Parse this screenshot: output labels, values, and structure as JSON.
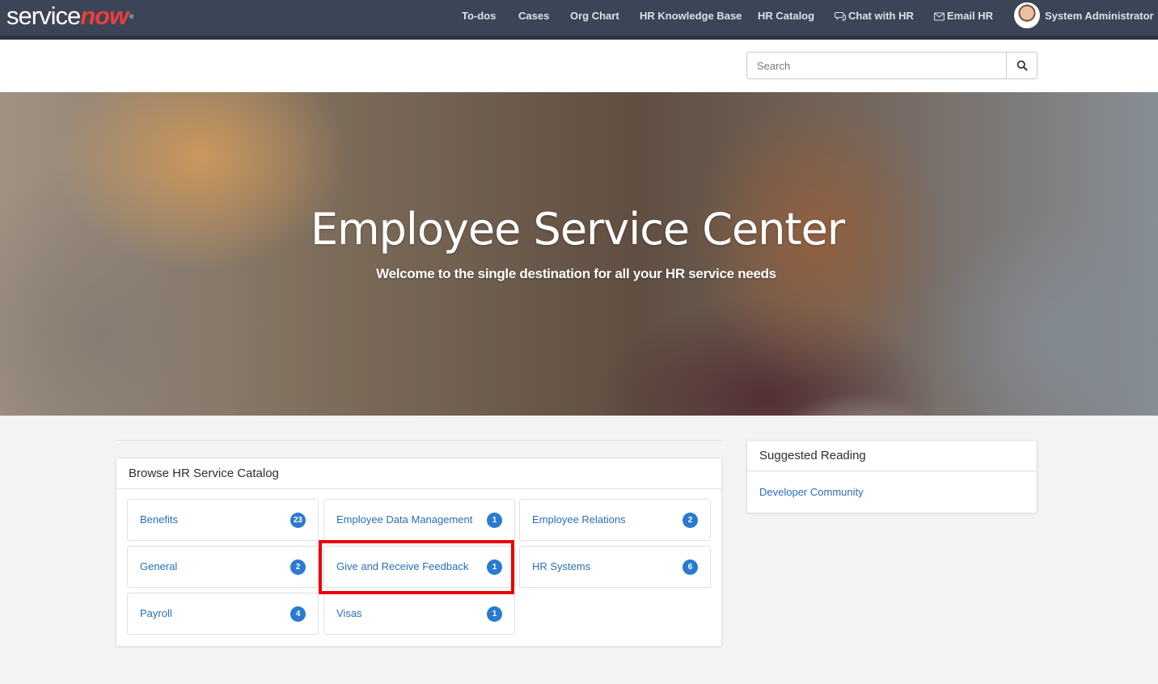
{
  "header": {
    "logo": {
      "part1": "service",
      "part2": "now"
    },
    "nav": [
      {
        "label": "To-dos"
      },
      {
        "label": "Cases"
      },
      {
        "label": "Org Chart"
      },
      {
        "label": "HR Knowledge Base"
      },
      {
        "label": "HR Catalog"
      },
      {
        "label": "Chat with HR",
        "icon": "chat-icon"
      },
      {
        "label": "Email HR",
        "icon": "envelope-icon"
      }
    ],
    "user": {
      "name": "System Administrator",
      "icon": "avatar"
    }
  },
  "search": {
    "placeholder": "Search",
    "value": "",
    "icon": "search-icon"
  },
  "hero": {
    "title": "Employee Service Center",
    "subtitle": "Welcome to the single destination for all your HR service needs"
  },
  "catalog": {
    "heading": "Browse HR Service Catalog",
    "items": [
      {
        "label": "Benefits",
        "count": "23"
      },
      {
        "label": "Employee Data Management",
        "count": "1"
      },
      {
        "label": "Employee Relations",
        "count": "2"
      },
      {
        "label": "General",
        "count": "2"
      },
      {
        "label": "Give and Receive Feedback",
        "count": "1"
      },
      {
        "label": "HR Systems",
        "count": "6"
      },
      {
        "label": "Payroll",
        "count": "4"
      },
      {
        "label": "Visas",
        "count": "1"
      }
    ]
  },
  "reading": {
    "heading": "Suggested Reading",
    "links": [
      {
        "label": "Developer Community"
      }
    ]
  },
  "colors": {
    "navbar": "#3c4457",
    "brand_accent": "#e8403a",
    "link": "#2a6ebb",
    "badge": "#2a7ad0",
    "highlight": "#ee0000"
  }
}
